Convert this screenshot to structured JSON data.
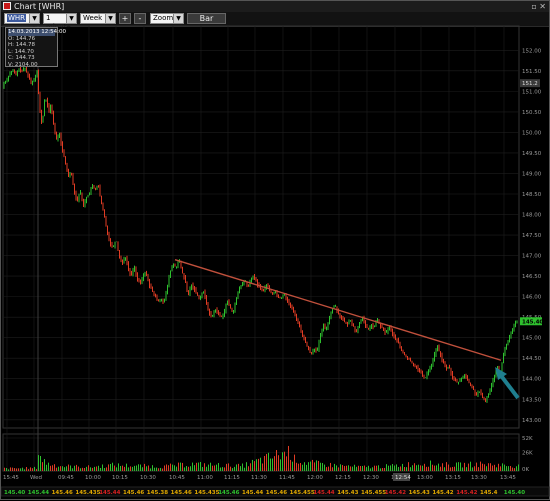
{
  "window": {
    "title": "Chart [WHR]",
    "controls": "▫ ✕"
  },
  "toolbar": {
    "symbol": "WHR",
    "interval": "1 minute",
    "range": "Week",
    "plus_label": "+",
    "minus_label": "-",
    "zoom_label": "Zoom",
    "type_button_label": "Bar"
  },
  "ohlc_box": {
    "date_time": "14.03.2013 12:54:00",
    "open": "O: 144.76",
    "high": "H: 144.78",
    "low": "L: 144.70",
    "close": "C: 144.73",
    "volume": "V: 2104.00"
  },
  "price_axis": {
    "labels": [
      "152.00",
      "151.50",
      "151.00",
      "150.50",
      "150.00",
      "149.50",
      "149.00",
      "148.50",
      "148.00",
      "147.50",
      "147.00",
      "146.50",
      "146.00",
      "145.50",
      "145.00",
      "144.50",
      "144.00",
      "143.50",
      "143.00"
    ],
    "current_price_label": "145.40",
    "crosshair_label": "151.2"
  },
  "volume_axis": {
    "labels": [
      "52K",
      "26K",
      "0K"
    ]
  },
  "time_axis": {
    "labels": [
      "15:45",
      "Wed",
      "09:45",
      "10:00",
      "10:15",
      "10:30",
      "10:45",
      "11:00",
      "11:15",
      "11:30",
      "11:45",
      "12:00",
      "12:15",
      "12:30",
      "12:45",
      "13:00",
      "13:15",
      "13:30",
      "13:45"
    ],
    "cursor_label": "12:54"
  },
  "bottom_strip": {
    "cells": [
      {
        "text": "145.40",
        "color": "#2ec02e"
      },
      {
        "text": "145.44",
        "color": "#2ec02e"
      },
      {
        "text": "145.46",
        "color": "#e0a800"
      },
      {
        "text": "145.435",
        "color": "#e0a800"
      },
      {
        "text": "145.44",
        "color": "#d82020"
      },
      {
        "text": "145.46",
        "color": "#e0a800"
      },
      {
        "text": "145.38",
        "color": "#e0a800"
      },
      {
        "text": "145.46",
        "color": "#e0a800"
      },
      {
        "text": "145.435",
        "color": "#e0a800"
      },
      {
        "text": "145.46",
        "color": "#2ec02e"
      },
      {
        "text": "145.44",
        "color": "#e0a800"
      },
      {
        "text": "145.46",
        "color": "#e0a800"
      },
      {
        "text": "145.455",
        "color": "#e0a800"
      },
      {
        "text": "145.44",
        "color": "#d82020"
      },
      {
        "text": "145.43",
        "color": "#e0a800"
      },
      {
        "text": "145.455",
        "color": "#e0a800"
      },
      {
        "text": "145.42",
        "color": "#d82020"
      },
      {
        "text": "145.43",
        "color": "#e0a800"
      },
      {
        "text": "145.42",
        "color": "#e0a800"
      },
      {
        "text": "145.42",
        "color": "#d82020"
      },
      {
        "text": "145.4",
        "color": "#e0a800"
      },
      {
        "text": "145.40",
        "color": "#2ec02e"
      }
    ]
  },
  "colors": {
    "up_bar": "#2ec02e",
    "down_bar": "#e03c24",
    "trendline": "#c0503c",
    "arrow": "#1f7f8f",
    "grid": "#1e1e1e"
  },
  "chart_data": {
    "type": "ohlc",
    "symbol": "WHR",
    "interval": "1 minute",
    "y_range": [
      142.8,
      152.3
    ],
    "volume_range": [
      0,
      52000
    ],
    "price_path": [
      [
        0,
        151.1
      ],
      [
        3,
        151.2
      ],
      [
        6,
        151.3
      ],
      [
        9,
        151.45
      ],
      [
        12,
        151.5
      ],
      [
        15,
        151.4
      ],
      [
        18,
        151.55
      ],
      [
        21,
        151.5
      ],
      [
        24,
        151.55
      ],
      [
        27,
        151.4
      ],
      [
        30,
        151.2
      ],
      [
        33,
        151.3
      ],
      [
        36,
        151.5
      ],
      [
        37,
        151.1
      ],
      [
        38,
        150.8
      ],
      [
        40,
        150.2
      ],
      [
        42,
        150.4
      ],
      [
        44,
        150.9
      ],
      [
        46,
        150.7
      ],
      [
        48,
        150.5
      ],
      [
        50,
        150.7
      ],
      [
        52,
        150.3
      ],
      [
        55,
        149.8
      ],
      [
        58,
        150.0
      ],
      [
        61,
        149.6
      ],
      [
        64,
        149.3
      ],
      [
        67,
        148.95
      ],
      [
        70,
        149.05
      ],
      [
        73,
        148.6
      ],
      [
        76,
        148.3
      ],
      [
        79,
        148.6
      ],
      [
        82,
        148.2
      ],
      [
        85,
        148.4
      ],
      [
        88,
        148.5
      ],
      [
        91,
        148.7
      ],
      [
        94,
        148.6
      ],
      [
        97,
        148.75
      ],
      [
        100,
        148.3
      ],
      [
        103,
        148.0
      ],
      [
        106,
        147.6
      ],
      [
        109,
        147.3
      ],
      [
        112,
        147.2
      ],
      [
        115,
        147.4
      ],
      [
        118,
        147.0
      ],
      [
        121,
        146.8
      ],
      [
        124,
        147.0
      ],
      [
        127,
        146.7
      ],
      [
        130,
        146.5
      ],
      [
        133,
        146.75
      ],
      [
        136,
        146.45
      ],
      [
        139,
        146.3
      ],
      [
        142,
        146.5
      ],
      [
        145,
        146.6
      ],
      [
        148,
        146.3
      ],
      [
        151,
        146.15
      ],
      [
        154,
        146.0
      ],
      [
        157,
        145.9
      ],
      [
        160,
        145.95
      ],
      [
        163,
        145.85
      ],
      [
        166,
        146.2
      ],
      [
        169,
        146.6
      ],
      [
        172,
        146.8
      ],
      [
        175,
        146.7
      ],
      [
        178,
        146.9
      ],
      [
        181,
        146.6
      ],
      [
        184,
        146.4
      ],
      [
        187,
        146.0
      ],
      [
        190,
        146.3
      ],
      [
        193,
        146.2
      ],
      [
        196,
        146.05
      ],
      [
        199,
        145.95
      ],
      [
        202,
        146.15
      ],
      [
        205,
        145.9
      ],
      [
        208,
        145.6
      ],
      [
        211,
        145.5
      ],
      [
        214,
        145.7
      ],
      [
        217,
        145.6
      ],
      [
        220,
        145.5
      ],
      [
        223,
        145.6
      ],
      [
        226,
        145.9
      ],
      [
        229,
        145.75
      ],
      [
        232,
        145.6
      ],
      [
        235,
        145.9
      ],
      [
        238,
        146.2
      ],
      [
        241,
        146.3
      ],
      [
        244,
        146.4
      ],
      [
        247,
        146.2
      ],
      [
        250,
        146.45
      ],
      [
        253,
        146.5
      ],
      [
        256,
        146.3
      ],
      [
        259,
        146.25
      ],
      [
        262,
        146.1
      ],
      [
        265,
        146.3
      ],
      [
        268,
        146.2
      ],
      [
        271,
        146.05
      ],
      [
        274,
        146.15
      ],
      [
        277,
        146.0
      ],
      [
        280,
        145.95
      ],
      [
        283,
        146.1
      ],
      [
        286,
        145.9
      ],
      [
        289,
        145.8
      ],
      [
        292,
        145.65
      ],
      [
        295,
        145.5
      ],
      [
        298,
        145.3
      ],
      [
        301,
        145.1
      ],
      [
        304,
        144.9
      ],
      [
        307,
        144.75
      ],
      [
        310,
        144.6
      ],
      [
        313,
        144.75
      ],
      [
        316,
        144.65
      ],
      [
        319,
        145.0
      ],
      [
        322,
        145.3
      ],
      [
        325,
        145.2
      ],
      [
        328,
        145.45
      ],
      [
        331,
        145.7
      ],
      [
        334,
        145.8
      ],
      [
        337,
        145.6
      ],
      [
        340,
        145.5
      ],
      [
        343,
        145.4
      ],
      [
        346,
        145.3
      ],
      [
        349,
        145.45
      ],
      [
        352,
        145.3
      ],
      [
        355,
        145.1
      ],
      [
        358,
        145.35
      ],
      [
        361,
        145.5
      ],
      [
        364,
        145.3
      ],
      [
        367,
        145.2
      ],
      [
        370,
        145.3
      ],
      [
        373,
        145.25
      ],
      [
        376,
        145.45
      ],
      [
        379,
        145.3
      ],
      [
        382,
        145.2
      ],
      [
        385,
        145.1
      ],
      [
        388,
        145.3
      ],
      [
        391,
        145.1
      ],
      [
        394,
        145.0
      ],
      [
        397,
        144.9
      ],
      [
        400,
        144.7
      ],
      [
        403,
        144.6
      ],
      [
        406,
        144.5
      ],
      [
        409,
        144.45
      ],
      [
        412,
        144.35
      ],
      [
        415,
        144.3
      ],
      [
        418,
        144.2
      ],
      [
        421,
        144.1
      ],
      [
        424,
        144.0
      ],
      [
        427,
        144.2
      ],
      [
        430,
        144.3
      ],
      [
        433,
        144.55
      ],
      [
        436,
        144.8
      ],
      [
        439,
        144.6
      ],
      [
        442,
        144.4
      ],
      [
        445,
        144.25
      ],
      [
        448,
        144.3
      ],
      [
        451,
        144.05
      ],
      [
        454,
        143.95
      ],
      [
        457,
        143.9
      ],
      [
        460,
        144.0
      ],
      [
        463,
        144.1
      ],
      [
        466,
        144.0
      ],
      [
        469,
        143.85
      ],
      [
        472,
        143.75
      ],
      [
        475,
        143.6
      ],
      [
        478,
        143.7
      ],
      [
        481,
        143.55
      ],
      [
        484,
        143.45
      ],
      [
        487,
        143.6
      ],
      [
        490,
        143.8
      ],
      [
        493,
        144.05
      ],
      [
        496,
        144.3
      ],
      [
        499,
        144.1
      ],
      [
        502,
        144.55
      ],
      [
        505,
        144.8
      ],
      [
        508,
        145.0
      ],
      [
        511,
        145.15
      ],
      [
        514,
        145.35
      ],
      [
        517,
        145.4
      ]
    ],
    "volume_profile": [
      [
        0,
        5
      ],
      [
        36,
        6
      ],
      [
        37,
        40
      ],
      [
        40,
        24
      ],
      [
        46,
        15
      ],
      [
        60,
        10
      ],
      [
        90,
        8
      ],
      [
        110,
        12
      ],
      [
        160,
        9
      ],
      [
        190,
        14
      ],
      [
        240,
        10
      ],
      [
        289,
        40
      ],
      [
        292,
        22
      ],
      [
        295,
        26
      ],
      [
        300,
        18
      ],
      [
        330,
        12
      ],
      [
        360,
        8
      ],
      [
        390,
        10
      ],
      [
        420,
        16
      ],
      [
        450,
        12
      ],
      [
        480,
        14
      ],
      [
        500,
        12
      ],
      [
        517,
        10
      ]
    ],
    "trendline": {
      "from": [
        "10:40",
        146.9
      ],
      "to": [
        "13:50",
        144.45
      ]
    },
    "current_price": 145.4
  }
}
